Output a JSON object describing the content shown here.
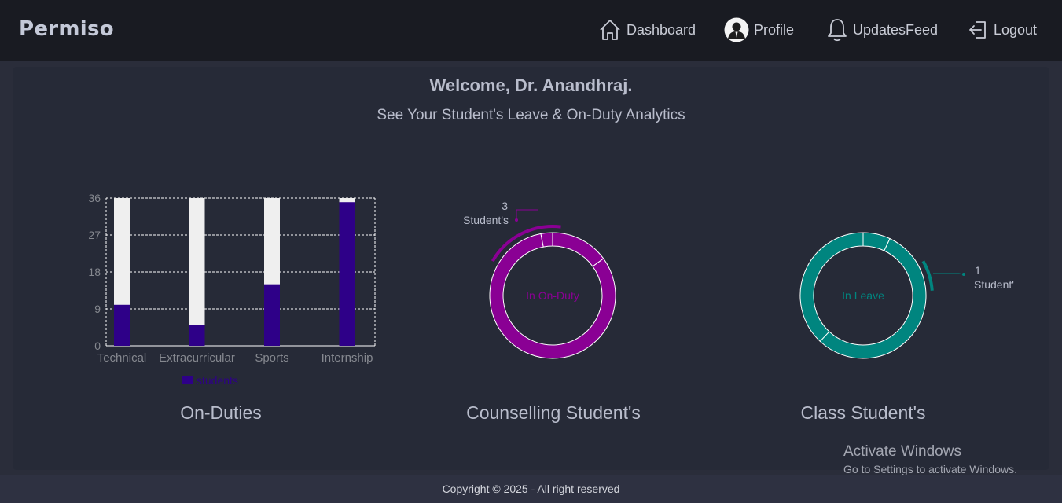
{
  "brand": "Permiso",
  "nav": {
    "dashboard": "Dashboard",
    "profile": "Profile",
    "updates": "UpdatesFeed",
    "logout": "Logout"
  },
  "welcome": "Welcome, Dr. Anandhraj.",
  "subtitle": "See Your Student's Leave & On-Duty Analytics",
  "charts": {
    "onduty_title": "On-Duties",
    "counselling_title": "Counselling Student's",
    "class_title": "Class Student's"
  },
  "chart_data": [
    {
      "type": "bar",
      "categories": [
        "Technical",
        "Extracurricular",
        "Sports",
        "Internship"
      ],
      "series": [
        {
          "name": "students",
          "values": [
            10,
            5,
            15,
            35
          ],
          "color": "#2e0088"
        }
      ],
      "ylim": [
        0,
        36
      ],
      "yticks": [
        0,
        9,
        18,
        27,
        36
      ],
      "grid": true,
      "legend_position": "bottom",
      "bar_background": "#efefef"
    },
    {
      "type": "pie",
      "center_label": "In On-Duty",
      "callout_value": "3",
      "callout_label": "Student's",
      "color": "#8a0094",
      "slices": [
        15,
        82,
        3
      ]
    },
    {
      "type": "pie",
      "center_label": "In Leave",
      "callout_value": "1",
      "callout_label": "Student'",
      "color": "#00857f",
      "slices": [
        7,
        55,
        38
      ]
    }
  ],
  "footer": "Copyright © 2025 - All right reserved",
  "watermark": {
    "title": "Activate Windows",
    "subtitle": "Go to Settings to activate Windows."
  }
}
